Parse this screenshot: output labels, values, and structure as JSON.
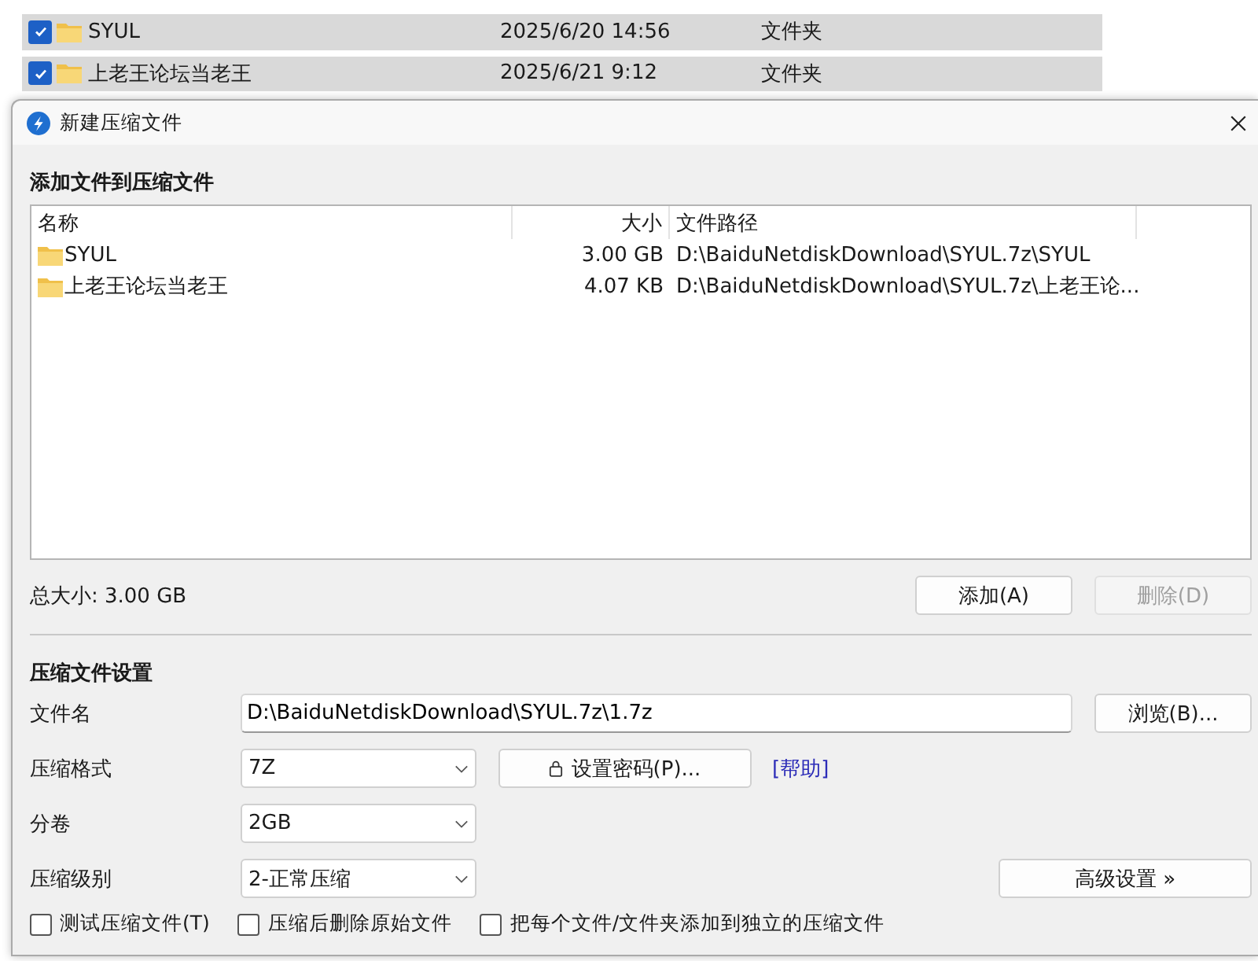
{
  "background_list": {
    "rows": [
      {
        "checked": true,
        "name": "SYUL",
        "date": "2025/6/20 14:56",
        "type": "文件夹"
      },
      {
        "checked": true,
        "name": "上老王论坛当老王",
        "date": "2025/6/21 9:12",
        "type": "文件夹"
      }
    ]
  },
  "dialog": {
    "title": "新建压缩文件",
    "add_section": {
      "heading": "添加文件到压缩文件",
      "columns": [
        "名称",
        "大小",
        "文件路径"
      ],
      "files": [
        {
          "name": "SYUL",
          "size": "3.00 GB",
          "path": "D:\\BaiduNetdiskDownload\\SYUL.7z\\SYUL"
        },
        {
          "name": "上老王论坛当老王",
          "size": "4.07 KB",
          "path": "D:\\BaiduNetdiskDownload\\SYUL.7z\\上老王论..."
        }
      ],
      "total_size": "总大小: 3.00 GB",
      "buttons": [
        {
          "label": "添加(A)",
          "disabled": false
        },
        {
          "label": "删除(D)",
          "disabled": true
        }
      ]
    },
    "settings": {
      "heading": "压缩文件设置",
      "rows": [
        {
          "label": "文件名",
          "kind": "text",
          "value": "D:\\BaiduNetdiskDownload\\SYUL.7z\\1.7z",
          "extras": [
            {
              "kind": "button",
              "label": "浏览(B)..."
            }
          ]
        },
        {
          "label": "压缩格式",
          "kind": "select",
          "value": "7Z",
          "extras": [
            {
              "kind": "password_button",
              "label": "设置密码(P)..."
            },
            {
              "kind": "link",
              "label": "[帮助]"
            }
          ]
        },
        {
          "label": "分卷",
          "kind": "select",
          "value": "2GB",
          "extras": []
        },
        {
          "label": "压缩级别",
          "kind": "select",
          "value": "2-正常压缩",
          "extras": [
            {
              "kind": "right_button",
              "label": "高级设置 »"
            }
          ]
        }
      ],
      "options": [
        {
          "label": "测试压缩文件(T)",
          "checked": false
        },
        {
          "label": "压缩后删除原始文件",
          "checked": false
        },
        {
          "label": "把每个文件/文件夹添加到独立的压缩文件",
          "checked": false
        }
      ]
    }
  }
}
